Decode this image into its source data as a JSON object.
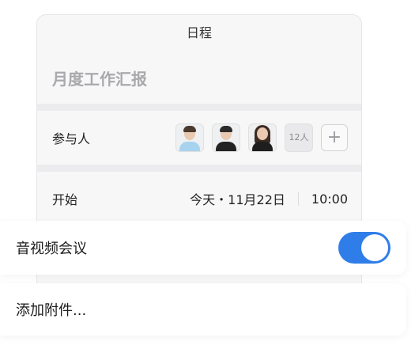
{
  "card": {
    "header_title": "日程",
    "event_title": "月度工作汇报"
  },
  "participants": {
    "label": "参与人",
    "count_badge": "12人",
    "add_symbol": "+"
  },
  "start": {
    "label": "开始",
    "date": "今天・11月22日",
    "time": "10:00"
  },
  "video_meeting": {
    "label": "音视频会议",
    "enabled": true,
    "toggle_color": "#2f7de8"
  },
  "attachment": {
    "label": "添加附件..."
  }
}
